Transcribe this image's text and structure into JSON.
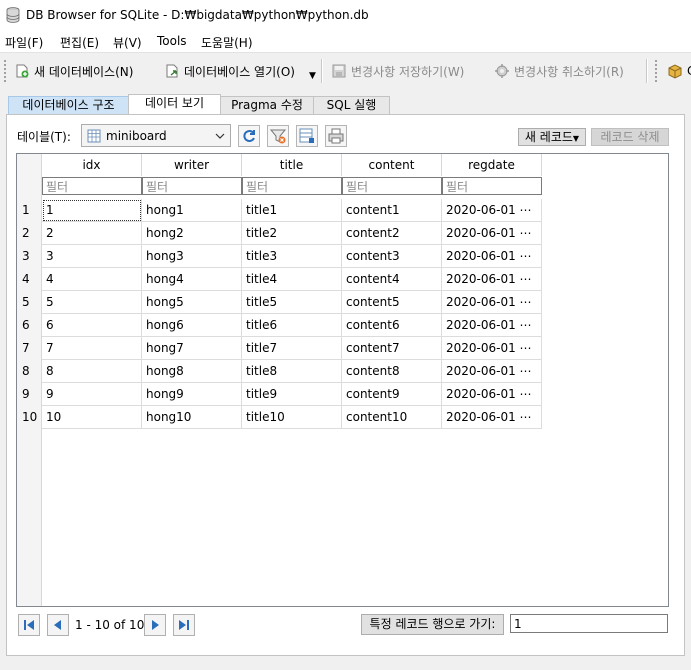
{
  "window": {
    "title": "DB Browser for SQLite - D:₩bigdata₩python₩python.db"
  },
  "menu": {
    "items": [
      "파일(F)",
      "편집(E)",
      "뷰(V)",
      "Tools",
      "도움말(H)"
    ]
  },
  "toolbar": {
    "new_db": "새 데이터베이스(N)",
    "open_db": "데이터베이스 열기(O)",
    "write_changes": "변경사항 저장하기(W)",
    "revert_changes": "변경사항 취소하기(R)",
    "extra": "C"
  },
  "tabs": [
    "데이터베이스 구조",
    "데이터 보기",
    "Pragma 수정",
    "SQL 실행"
  ],
  "browse": {
    "table_label": "테이블(T):",
    "table_value": "miniboard",
    "new_record": "새 레코드",
    "delete_record": "레코드 삭제"
  },
  "grid": {
    "columns": [
      "idx",
      "writer",
      "title",
      "content",
      "regdate"
    ],
    "filter_placeholder": "필터",
    "rows": [
      [
        "1",
        "1",
        "hong1",
        "title1",
        "content1",
        "2020-06-01 ⋯"
      ],
      [
        "2",
        "2",
        "hong2",
        "title2",
        "content2",
        "2020-06-01 ⋯"
      ],
      [
        "3",
        "3",
        "hong3",
        "title3",
        "content3",
        "2020-06-01 ⋯"
      ],
      [
        "4",
        "4",
        "hong4",
        "title4",
        "content4",
        "2020-06-01 ⋯"
      ],
      [
        "5",
        "5",
        "hong5",
        "title5",
        "content5",
        "2020-06-01 ⋯"
      ],
      [
        "6",
        "6",
        "hong6",
        "title6",
        "content6",
        "2020-06-01 ⋯"
      ],
      [
        "7",
        "7",
        "hong7",
        "title7",
        "content7",
        "2020-06-01 ⋯"
      ],
      [
        "8",
        "8",
        "hong8",
        "title8",
        "content8",
        "2020-06-01 ⋯"
      ],
      [
        "9",
        "9",
        "hong9",
        "title9",
        "content9",
        "2020-06-01 ⋯"
      ],
      [
        "10",
        "10",
        "hong10",
        "title10",
        "content10",
        "2020-06-01 ⋯"
      ]
    ]
  },
  "nav": {
    "range": "1 - 10 of 10",
    "goto_label": "특정 레코드 행으로 가기:",
    "goto_value": "1"
  },
  "colors": {
    "accent": "#2a6ebb",
    "tab_highlight": "#cfe3f6"
  }
}
